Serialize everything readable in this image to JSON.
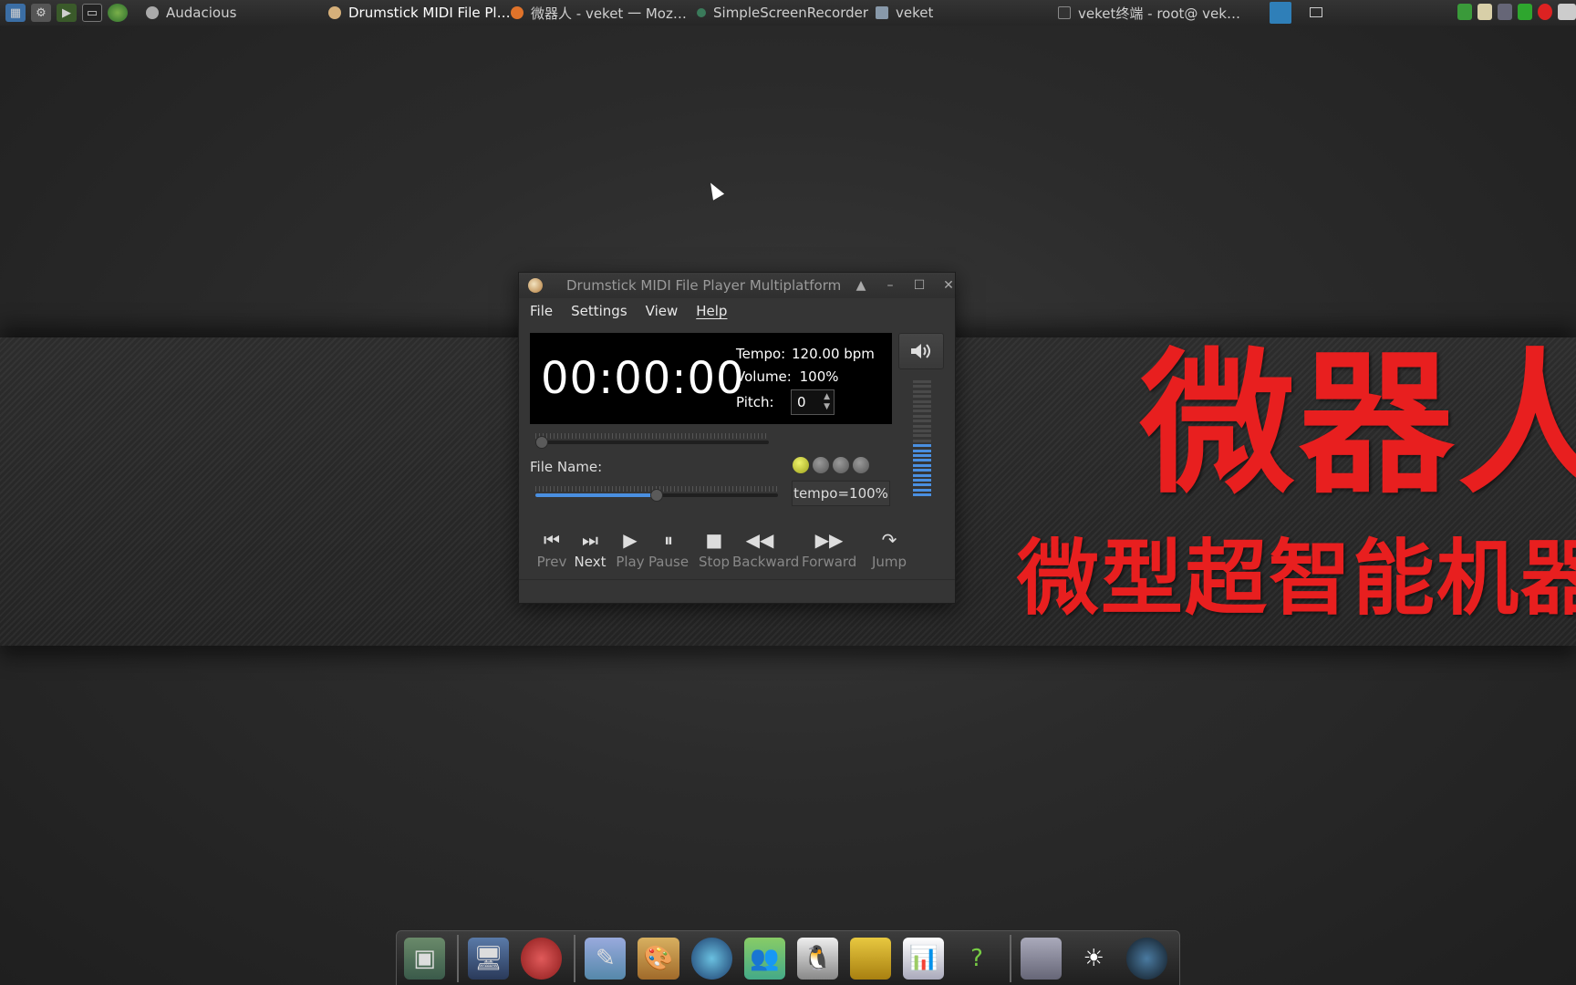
{
  "taskbar": {
    "launchers": [
      "monitor-icon",
      "settings-icon",
      "run-icon",
      "terminal-icon",
      "globe-icon"
    ],
    "tasks": [
      {
        "label": "Audacious",
        "icon": "audio-icon"
      },
      {
        "label": "Drumstick MIDI File Pl…",
        "icon": "drumstick-icon"
      },
      {
        "label": "微器人 - veket 一 Moz…",
        "icon": "firefox-icon"
      },
      {
        "label": "SimpleScreenRecorder",
        "icon": "recorder-icon"
      },
      {
        "label": "veket",
        "icon": "folder-icon"
      },
      {
        "label": "veket终端 - root@ vek…",
        "icon": "terminal-icon"
      }
    ]
  },
  "banner": {
    "title": "微器人",
    "subtitle": "微型超智能机器"
  },
  "player": {
    "window_title": "Drumstick MIDI File Player Multiplatform",
    "menu": [
      "File",
      "Settings",
      "View",
      "Help"
    ],
    "clock": "00:00:00",
    "tempo_label": "Tempo:",
    "tempo_value": "120.00 bpm",
    "volume_label": "Volume:",
    "volume_value": "100%",
    "pitch_label": "Pitch:",
    "pitch_value": "0",
    "file_name_label": "File Name:",
    "tempo_button": "tempo=100%",
    "tempo_slider_fraction": 0.5,
    "position_slider_fraction": 0.0,
    "volume_level_fraction": 0.45,
    "controls": [
      {
        "label": "Prev",
        "sym": "⏮",
        "enabled": false
      },
      {
        "label": "Next",
        "sym": "⏭",
        "enabled": true
      },
      {
        "label": "Play",
        "sym": "▶",
        "enabled": false
      },
      {
        "label": "Pause",
        "sym": "⏸",
        "enabled": false
      },
      {
        "label": "Stop",
        "sym": "■",
        "enabled": false
      },
      {
        "label": "Backward",
        "sym": "◀◀",
        "enabled": false
      },
      {
        "label": "Forward",
        "sym": "▶▶",
        "enabled": false
      },
      {
        "label": "Jump",
        "sym": "↷",
        "enabled": false
      }
    ]
  },
  "dock": {
    "items": [
      "desktop-icon",
      "computer-icon",
      "mascot-icon",
      "editor-icon",
      "paint-icon",
      "media-icon",
      "users-icon",
      "penguin-icon",
      "notes-icon",
      "chart-icon",
      "help-icon",
      "drive-icon",
      "brightness-icon",
      "camera-icon"
    ]
  },
  "colors": {
    "brand_red": "#e81f1f",
    "led_on": "#d8dc3a",
    "accent_blue": "#4a8fe0"
  }
}
